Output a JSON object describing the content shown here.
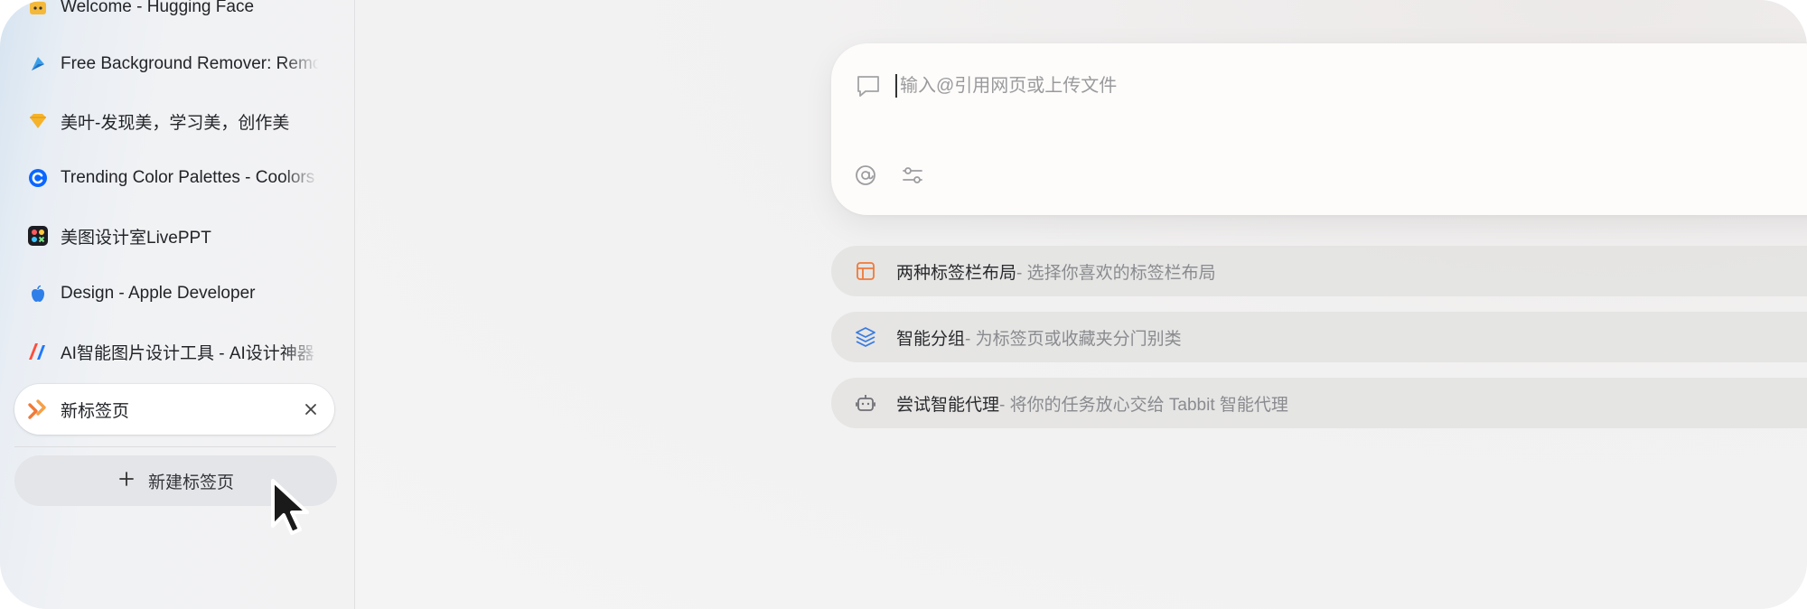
{
  "sidebar": {
    "tabs": [
      {
        "label": "Welcome - Hugging Face",
        "icon": "hugging-face-icon"
      },
      {
        "label": "Free Background Remover: Remove",
        "icon": "background-remover-icon"
      },
      {
        "label": "美叶-发现美，学习美，创作美",
        "icon": "meiye-icon"
      },
      {
        "label": "Trending Color Palettes - Coolors",
        "icon": "coolors-icon"
      },
      {
        "label": "美图设计室LivePPT",
        "icon": "meitu-icon"
      },
      {
        "label": "Design - Apple Developer",
        "icon": "apple-icon"
      },
      {
        "label": "AI智能图片设计工具 - AI设计神器",
        "icon": "ai-design-icon"
      },
      {
        "label": "新标签页",
        "icon": "tabbit-icon",
        "active": true
      }
    ],
    "new_tab_label": "新建标签页"
  },
  "main": {
    "input": {
      "placeholder": "输入@引用网页或上传文件",
      "value": ""
    },
    "suggestions": [
      {
        "title": "两种标签栏布局",
        "desc": " - 选择你喜欢的标签栏布局",
        "icon": "layout-icon"
      },
      {
        "title": "智能分组",
        "desc": " - 为标签页或收藏夹分门别类",
        "icon": "layers-icon"
      },
      {
        "title": "尝试智能代理",
        "desc": " - 将你的任务放心交给 Tabbit 智能代理",
        "icon": "robot-icon"
      }
    ]
  },
  "colors": {
    "accent_orange": "#f07a3a",
    "accent_blue": "#3a7be0"
  }
}
